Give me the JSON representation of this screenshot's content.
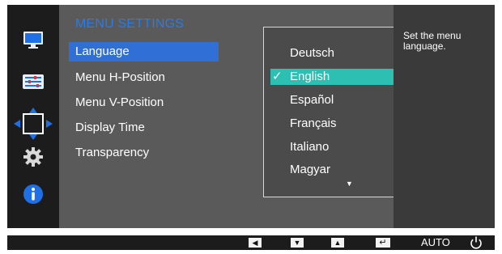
{
  "colors": {
    "menu_title": "#2b7be4",
    "selected_item": "#2f6fd6",
    "selected_option": "#2cbfb2",
    "osd_background": "#393939"
  },
  "left_rail": {
    "icons": [
      "monitor-icon",
      "adjust-sliders-icon",
      "move-arrows-icon",
      "gear-icon",
      "info-icon"
    ],
    "active": "move-arrows-icon"
  },
  "menu": {
    "title": "MENU SETTINGS",
    "items": [
      {
        "label": "Language",
        "selected": true
      },
      {
        "label": "Menu H-Position"
      },
      {
        "label": "Menu V-Position"
      },
      {
        "label": "Display Time"
      },
      {
        "label": "Transparency"
      }
    ]
  },
  "dropdown": {
    "options": [
      {
        "label": "Deutsch"
      },
      {
        "label": "English",
        "selected": true
      },
      {
        "label": "Español"
      },
      {
        "label": "Français"
      },
      {
        "label": "Italiano"
      },
      {
        "label": "Magyar"
      }
    ],
    "scroll_indicator": "▼",
    "check_glyph": "✓"
  },
  "help": {
    "text": "Set the menu language."
  },
  "footer": {
    "left_glyph": "◀",
    "down_glyph": "▼",
    "up_glyph": "▲",
    "enter_glyph": "↵",
    "auto_label": "AUTO"
  }
}
